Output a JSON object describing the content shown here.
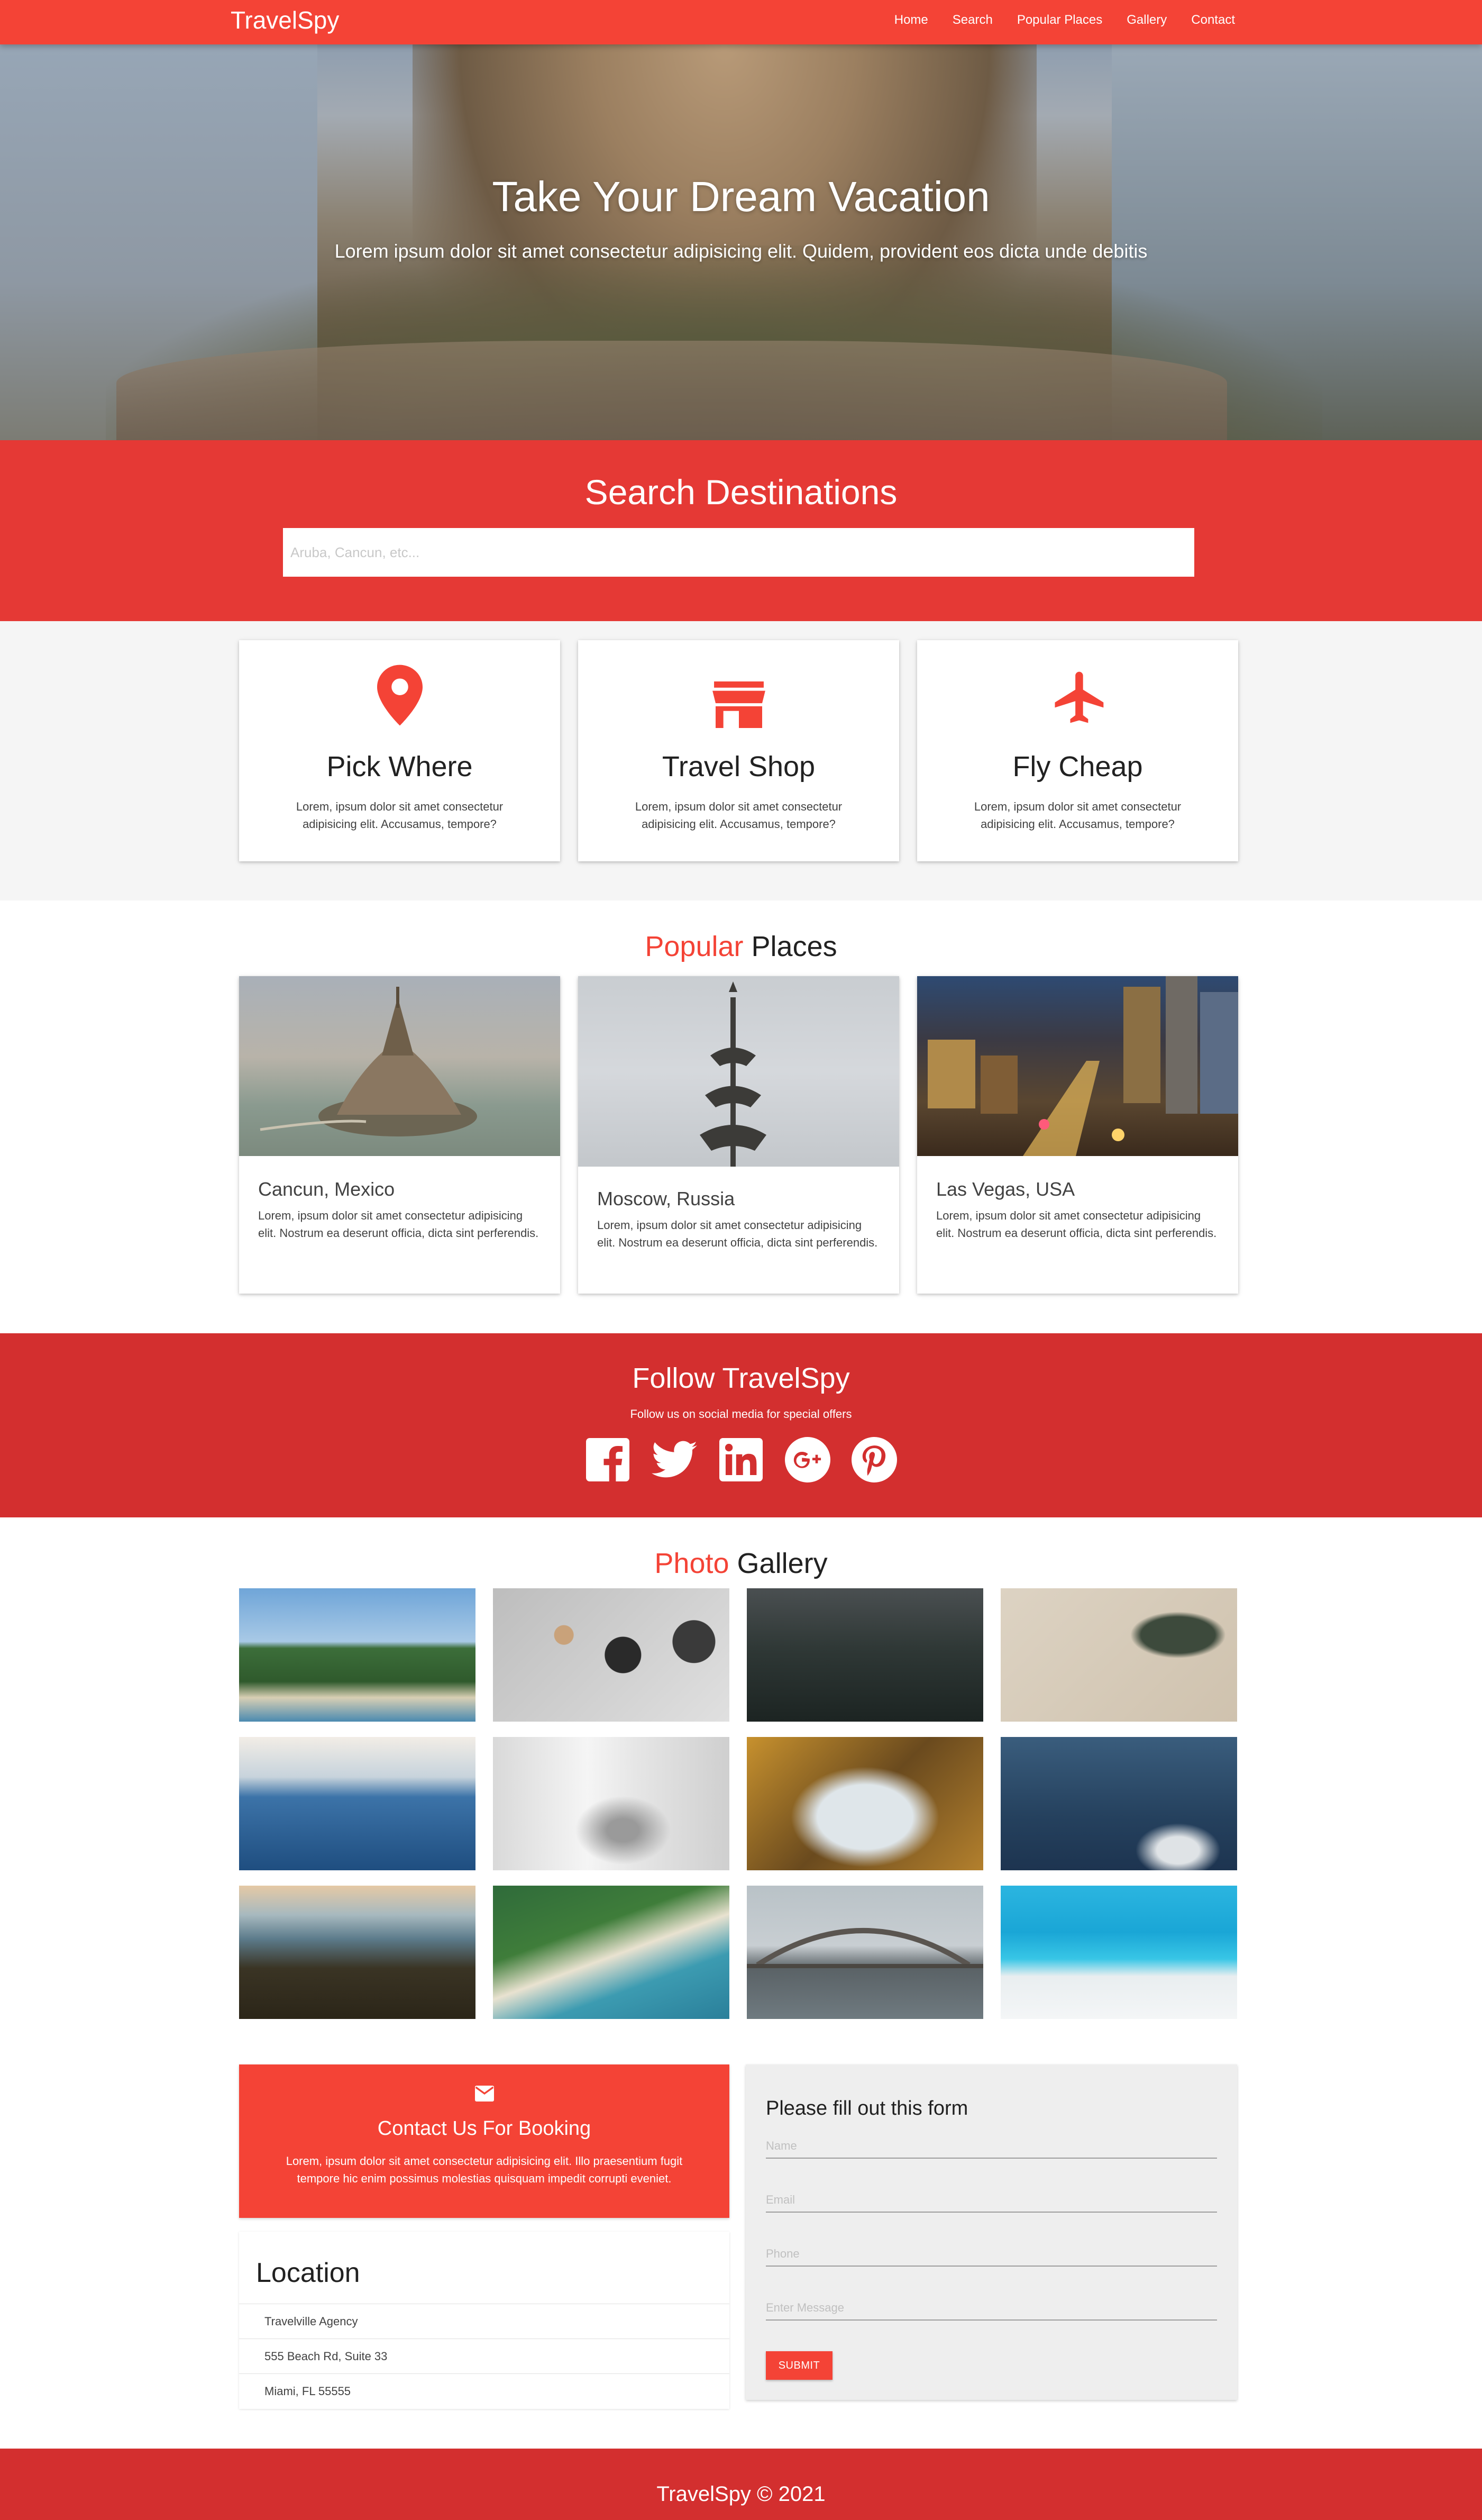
{
  "nav": {
    "brand": "TravelSpy",
    "links": [
      "Home",
      "Search",
      "Popular Places",
      "Gallery",
      "Contact"
    ]
  },
  "hero": {
    "title": "Take Your Dream Vacation",
    "subtitle": "Lorem ipsum dolor sit amet consectetur adipisicing elit. Quidem, provident eos dicta unde debitis"
  },
  "search": {
    "title": "Search Destinations",
    "placeholder": "Aruba, Cancun, etc..."
  },
  "features": [
    {
      "icon": "map-pin-icon",
      "title": "Pick Where",
      "text": "Lorem, ipsum dolor sit amet consectetur adipisicing elit. Accusamus, tempore?"
    },
    {
      "icon": "store-icon",
      "title": "Travel Shop",
      "text": "Lorem, ipsum dolor sit amet consectetur adipisicing elit. Accusamus, tempore?"
    },
    {
      "icon": "airplane-icon",
      "title": "Fly Cheap",
      "text": "Lorem, ipsum dolor sit amet consectetur adipisicing elit. Accusamus, tempore?"
    }
  ],
  "popular": {
    "title_accent": "Popular",
    "title_rest": " Places",
    "places": [
      {
        "name": "Cancun, Mexico",
        "text": "Lorem, ipsum dolor sit amet consectetur adipisicing elit. Nostrum ea deserunt officia, dicta sint perferendis."
      },
      {
        "name": "Moscow, Russia",
        "text": "Lorem, ipsum dolor sit amet consectetur adipisicing elit. Nostrum ea deserunt officia, dicta sint perferendis."
      },
      {
        "name": "Las Vegas, USA",
        "text": "Lorem, ipsum dolor sit amet consectetur adipisicing elit. Nostrum ea deserunt officia, dicta sint perferendis."
      }
    ]
  },
  "follow": {
    "title": "Follow TravelSpy",
    "subtitle": "Follow us on social media for special offers",
    "icons": [
      "facebook-icon",
      "twitter-icon",
      "linkedin-icon",
      "google-plus-icon",
      "pinterest-icon"
    ]
  },
  "gallery": {
    "title_accent": "Photo",
    "title_rest": " Gallery"
  },
  "contact": {
    "title": "Contact Us For Booking",
    "text": "Lorem, ipsum dolor sit amet consectetur adipisicing elit. Illo praesentium fugit tempore hic enim possimus molestias quisquam impedit corrupti eveniet.",
    "icon": "envelope-icon"
  },
  "location": {
    "title": "Location",
    "lines": [
      "Travelville Agency",
      "555 Beach Rd, Suite 33",
      "Miami, FL 55555"
    ]
  },
  "form": {
    "title": "Please fill out this form",
    "name_placeholder": "Name",
    "email_placeholder": "Email",
    "phone_placeholder": "Phone",
    "message_placeholder": "Enter Message",
    "submit_label": "SUBMIT"
  },
  "footer": {
    "text": "TravelSpy © 2021"
  },
  "colors": {
    "primary": "#f44336",
    "primary_dark": "#d32f2f",
    "search_bg": "#e53935"
  }
}
